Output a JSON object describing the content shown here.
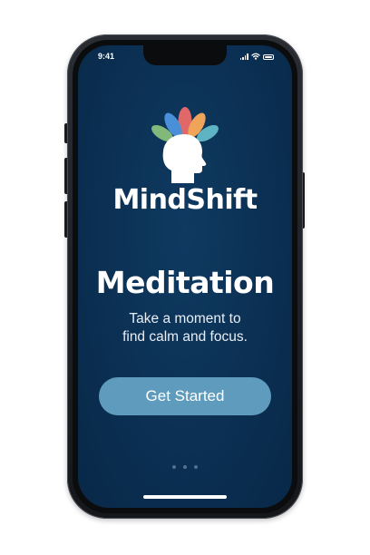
{
  "status_bar": {
    "time": "9:41",
    "icons": [
      "cellular-signal-icon",
      "wifi-icon",
      "battery-icon"
    ]
  },
  "app": {
    "logo_icon": "lotus-head-logo",
    "name": "MindShift"
  },
  "onboarding": {
    "title": "Meditation",
    "subtitle_lines": [
      "Take a moment to",
      "find calm and focus."
    ],
    "cta_label": "Get Started",
    "page_indicator": {
      "total": 3
    }
  },
  "colors": {
    "background": "#0a2d4f",
    "button": "#5e9bbd",
    "text": "#ffffff",
    "petal_blue": "#4a90d9",
    "petal_red": "#e06868",
    "petal_orange": "#f0a45a",
    "petal_green": "#82b87a",
    "petal_teal": "#5fb4c4"
  }
}
